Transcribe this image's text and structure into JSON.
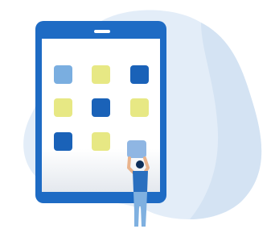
{
  "illustration": {
    "subject": "tablet-app-grid-with-person",
    "colors": {
      "background": "#ffffff",
      "blob": "#dde9f6",
      "tablet_frame": "#1e6bc4",
      "screen": "#ffffff",
      "tile_light_blue": "#7aaee0",
      "tile_yellow": "#e7e884",
      "tile_dark_blue": "#1a62b8",
      "held_tile": "#8fb6e3",
      "person_shirt": "#2a6fbf",
      "person_pants": "#7fb0e0",
      "person_skin": "#e9b38c",
      "person_hair": "#0e2f5a"
    },
    "app_grid": {
      "rows": 3,
      "columns": 3,
      "tiles": [
        {
          "id": "r1c1",
          "color": "light-blue"
        },
        {
          "id": "r1c2",
          "color": "yellow"
        },
        {
          "id": "r1c3",
          "color": "dark-blue"
        },
        {
          "id": "r2c1",
          "color": "yellow"
        },
        {
          "id": "r2c2",
          "color": "dark-blue"
        },
        {
          "id": "r2c3",
          "color": "yellow"
        },
        {
          "id": "r3c1",
          "color": "dark-blue"
        },
        {
          "id": "r3c2",
          "color": "yellow"
        },
        {
          "id": "r3c3",
          "color": "empty"
        }
      ]
    }
  }
}
